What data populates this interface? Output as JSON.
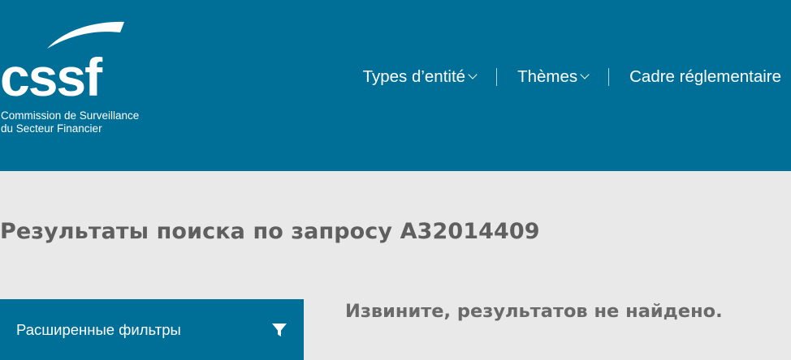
{
  "header": {
    "logo": {
      "wordmark": "cssf",
      "subtitle_line1": "Commission de Surveillance",
      "subtitle_line2": "du Secteur Financier"
    },
    "nav": [
      {
        "label": "Types d’entité",
        "has_dropdown": true
      },
      {
        "label": "Thèmes",
        "has_dropdown": true
      },
      {
        "label": "Cadre réglementaire",
        "has_dropdown": false
      }
    ]
  },
  "main": {
    "title": "Результаты поиска по запросу A32014409",
    "filters_button": {
      "label": "Расширенные фильтры",
      "icon": "filter-icon"
    },
    "no_results": "Извините, результатов не найдено."
  },
  "colors": {
    "brand_blue": "#006f98",
    "background": "#e9e9e9",
    "title_text": "#5f5f5f"
  }
}
